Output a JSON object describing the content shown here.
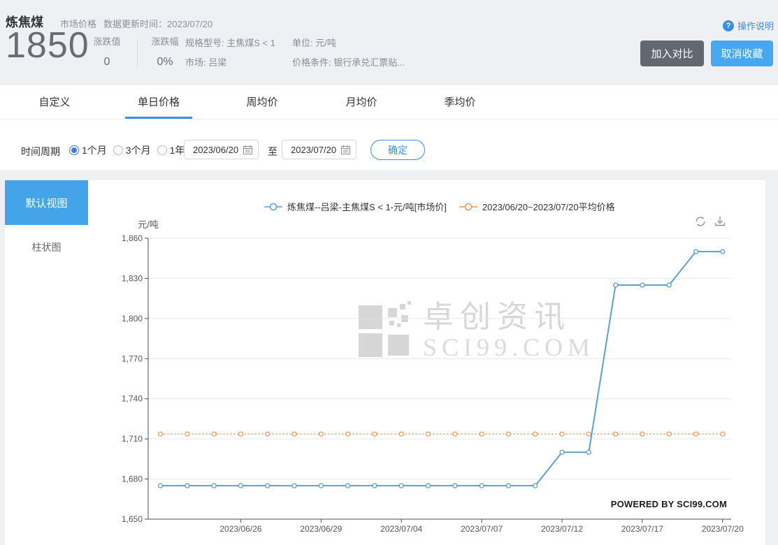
{
  "header": {
    "title": "炼焦煤",
    "category": "市场价格",
    "update_label": "数据更新时间：",
    "update_value": "2023/07/20",
    "help": "操作说明",
    "price": "1850",
    "change": {
      "label": "涨跌值",
      "value": "0"
    },
    "change_pct": {
      "label": "涨跌幅",
      "value": "0%"
    },
    "spec": {
      "label": "规格型号:",
      "value": "主焦煤S < 1"
    },
    "market": {
      "label": "市场:",
      "value": "吕梁"
    },
    "unit": {
      "label": "单位:",
      "value": "元/吨"
    },
    "condition": {
      "label": "价格条件:",
      "value": "银行承兑汇票贴..."
    },
    "compare_button": "加入对比",
    "unfavorite_button": "取消收藏"
  },
  "tabs": {
    "items": [
      {
        "label": "自定义"
      },
      {
        "label": "单日价格",
        "active": true
      },
      {
        "label": "周均价"
      },
      {
        "label": "月均价"
      },
      {
        "label": "季均价"
      }
    ]
  },
  "filter": {
    "label": "时间周期",
    "options": [
      {
        "label": "1个月",
        "selected": true
      },
      {
        "label": "3个月",
        "selected": false
      },
      {
        "label": "1年",
        "selected": false
      }
    ],
    "from": "2023/06/20",
    "to_word": "至",
    "to": "2023/07/20",
    "confirm": "确定"
  },
  "sidebar": {
    "items": [
      {
        "label": "默认视图",
        "active": true
      },
      {
        "label": "柱状图",
        "active": false
      }
    ]
  },
  "watermark": {
    "cn": "卓创资讯",
    "en": "SCI99.COM"
  },
  "powered_by": "POWERED BY SCI99.COM",
  "colors": {
    "accent_blue": "#3a8ee6",
    "favorite_button_blue": "#47a7f0",
    "compare_button_gray": "#62686f",
    "sidebar_active_blue": "#45a3e9",
    "series_blue": "#5ba0d0",
    "series_orange": "#ed9254"
  },
  "chart_data": {
    "type": "line",
    "title": "",
    "xlabel": "",
    "ylabel": "元/吨",
    "ylim": [
      1650,
      1860
    ],
    "ytick_step": 30,
    "grid": true,
    "legend_position": "top",
    "x": [
      "2023/06/20",
      "2023/06/21",
      "2023/06/25",
      "2023/06/26",
      "2023/06/27",
      "2023/06/28",
      "2023/06/29",
      "2023/06/30",
      "2023/07/03",
      "2023/07/04",
      "2023/07/05",
      "2023/07/06",
      "2023/07/07",
      "2023/07/10",
      "2023/07/11",
      "2023/07/12",
      "2023/07/13",
      "2023/07/14",
      "2023/07/17",
      "2023/07/18",
      "2023/07/19",
      "2023/07/20"
    ],
    "xtick_indices": [
      3,
      6,
      9,
      12,
      15,
      18,
      21
    ],
    "xtick_labels": [
      "2023/06/26",
      "2023/06/29",
      "2023/07/04",
      "2023/07/07",
      "2023/07/12",
      "2023/07/17",
      "2023/07/20"
    ],
    "series": [
      {
        "name": "炼焦煤--吕梁-主焦煤S < 1-元/吨[市场价]",
        "color": "#5ba0d0",
        "style": "solid",
        "values": [
          1675,
          1675,
          1675,
          1675,
          1675,
          1675,
          1675,
          1675,
          1675,
          1675,
          1675,
          1675,
          1675,
          1675,
          1675,
          1700,
          1700,
          1825,
          1825,
          1825,
          1850,
          1850
        ]
      },
      {
        "name": "2023/06/20~2023/07/20平均价格",
        "color": "#ed9254",
        "style": "dotted",
        "avg_value": 1713.64
      }
    ]
  }
}
